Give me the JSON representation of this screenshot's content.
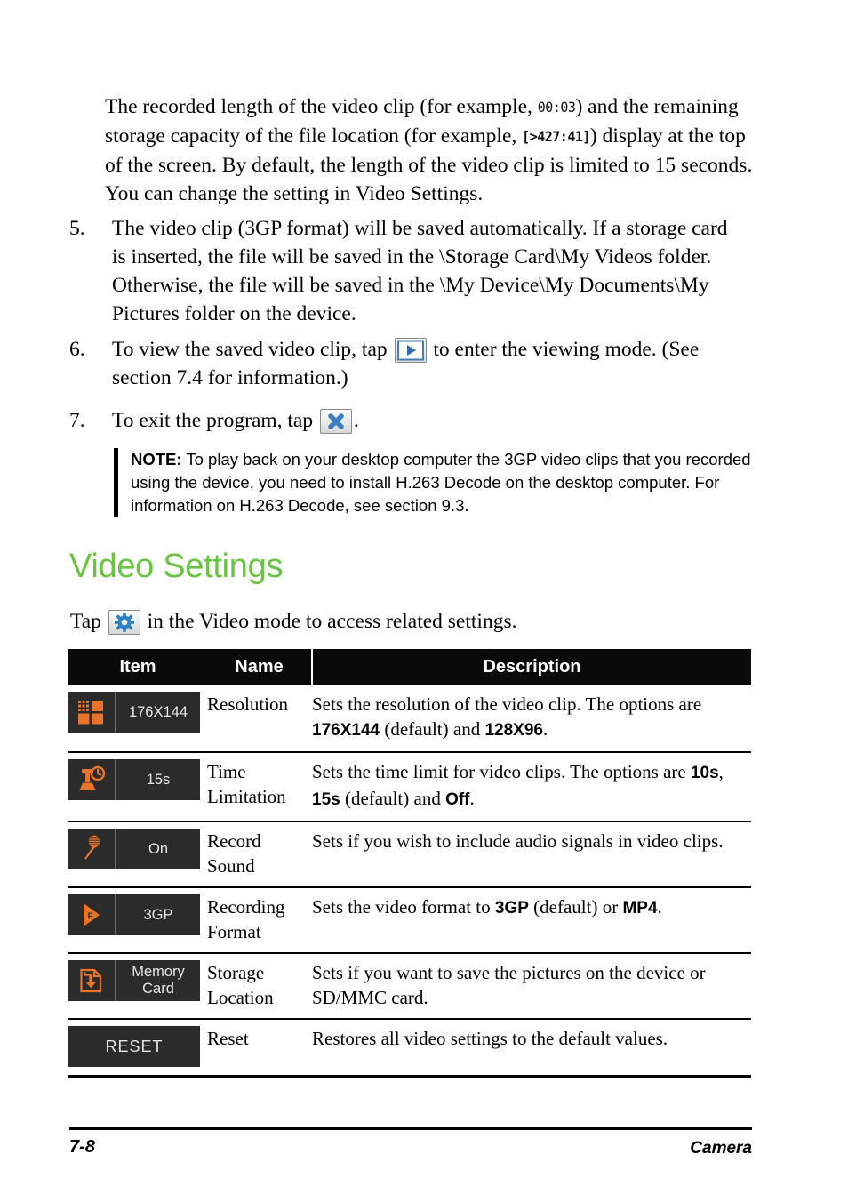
{
  "page": {
    "intro_paragraph_parts": {
      "a": "The recorded length of the video clip (for example, ",
      "lcd1": "00:03",
      "b": ") and the remaining storage capacity of the file location (for example, ",
      "lcd2": "[>427:41]",
      "c": ") display at the top of the screen. By default, the length of the video clip is limited to 15 seconds. You can change the setting in Video Settings."
    },
    "steps": [
      {
        "number": "5.",
        "text": "The video clip (3GP format) will be saved automatically. If a storage card is inserted, the file will be saved in the \\Storage Card\\My Videos folder. Otherwise, the file will be saved in the \\My Device\\My Documents\\My Pictures folder on the device."
      },
      {
        "number": "6.",
        "text_before": "To view the saved video clip, tap ",
        "icon": "play-icon",
        "text_after": " to enter the viewing mode. (See section 7.4 for information.)"
      },
      {
        "number": "7.",
        "text_before": "To exit the program, tap ",
        "icon": "close-x-icon",
        "text_after": "."
      }
    ],
    "note": {
      "label": "NOTE:",
      "text": " To play back on your desktop computer the 3GP video clips that you recorded using the device, you need to install H.263 Decode on the desktop computer. For information on H.263 Decode, see section 9.3."
    },
    "heading": "Video Settings",
    "heading_color": "#6ac442",
    "tap_line": {
      "before": "Tap ",
      "icon": "gear-icon",
      "after": " in the Video mode to access related settings."
    },
    "table": {
      "headers": [
        "Item",
        "Name",
        "Description"
      ],
      "rows": [
        {
          "icon": "resolution-grid-icon",
          "chip_label": "176X144",
          "name": "Resolution",
          "desc_parts": [
            {
              "t": "Sets the resolution of the video clip. The options are ",
              "b": false
            },
            {
              "t": "176X144",
              "b": true
            },
            {
              "t": " (default) and ",
              "b": false
            },
            {
              "t": "128X96",
              "b": true
            },
            {
              "t": ".",
              "b": false
            }
          ]
        },
        {
          "icon": "timer-icon",
          "chip_label": "15s",
          "name": "Time Limitation",
          "desc_parts": [
            {
              "t": "Sets the time limit for video clips. The options are ",
              "b": false
            },
            {
              "t": "10s",
              "b": true
            },
            {
              "t": ", ",
              "b": false
            },
            {
              "t": "15s",
              "b": true
            },
            {
              "t": " (default) and ",
              "b": false
            },
            {
              "t": "Off",
              "b": true
            },
            {
              "t": ".",
              "b": false
            }
          ]
        },
        {
          "icon": "microphone-icon",
          "chip_label": "On",
          "name": "Record Sound",
          "desc_parts": [
            {
              "t": "Sets if you wish to include audio signals in video clips.",
              "b": false
            }
          ]
        },
        {
          "icon": "format-flag-icon",
          "chip_label": "3GP",
          "name": "Recording Format",
          "desc_parts": [
            {
              "t": "Sets the video format to ",
              "b": false
            },
            {
              "t": "3GP",
              "b": true
            },
            {
              "t": " (default) or ",
              "b": false
            },
            {
              "t": "MP4",
              "b": true
            },
            {
              "t": ".",
              "b": false
            }
          ]
        },
        {
          "icon": "memory-card-save-icon",
          "chip_label": "Memory\nCard",
          "name": "Storage Location",
          "desc_parts": [
            {
              "t": "Sets if you want to save the pictures on the device or SD/MMC card.",
              "b": false
            }
          ]
        },
        {
          "icon": "none",
          "chip_label": "RESET",
          "chip_plain": true,
          "name": "Reset",
          "desc_parts": [
            {
              "t": "Restores all video settings to the default values.",
              "b": false
            }
          ]
        }
      ]
    },
    "footer": {
      "page_number": "7-8",
      "section": "Camera"
    },
    "colors": {
      "accent_green": "#6ac442",
      "chip_background": "#2b2b2b",
      "icon_orange": "#e8732a",
      "header_black": "#0a0a0a"
    }
  }
}
